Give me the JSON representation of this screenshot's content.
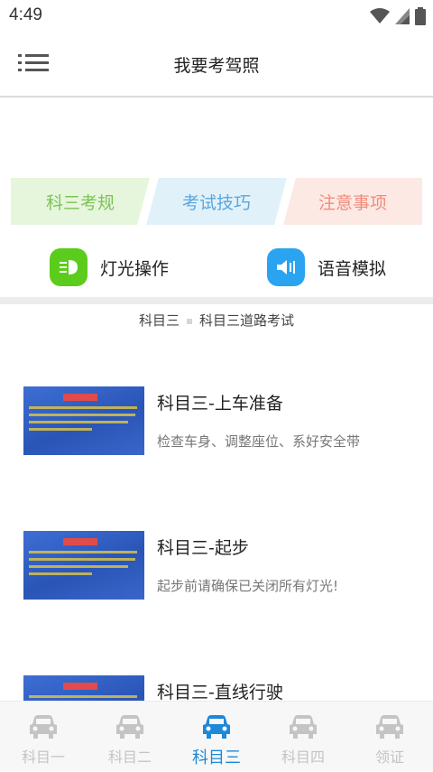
{
  "status": {
    "time": "4:49"
  },
  "header": {
    "title": "我要考驾照",
    "menu_icon": "menu-list-icon"
  },
  "pill_tabs": [
    {
      "label": "科三考规",
      "text_color": "#7cc356",
      "bg_color": "#e6f6dc"
    },
    {
      "label": "考试技巧",
      "text_color": "#5aa6dc",
      "bg_color": "#e1f1fa"
    },
    {
      "label": "注意事项",
      "text_color": "#f08c7c",
      "bg_color": "#fde9e4"
    }
  ],
  "features": [
    {
      "label": "灯光操作",
      "icon": "headlight-icon",
      "color": "#5ccc1c"
    },
    {
      "label": "语音模拟",
      "icon": "speaker-icon",
      "color": "#2aa4f0"
    }
  ],
  "breadcrumb": {
    "first": "科目三",
    "second": "科目三道路考试"
  },
  "lessons": [
    {
      "title": "科目三-上车准备",
      "subtitle": "检查车身、调整座位、系好安全带"
    },
    {
      "title": "科目三-起步",
      "subtitle": "起步前请确保已关闭所有灯光!"
    },
    {
      "title": "科目三-直线行驶",
      "subtitle": ""
    }
  ],
  "bottom_nav": [
    {
      "label": "科目一",
      "active": false
    },
    {
      "label": "科目二",
      "active": false
    },
    {
      "label": "科目三",
      "active": true
    },
    {
      "label": "科目四",
      "active": false
    },
    {
      "label": "领证",
      "active": false
    }
  ],
  "colors": {
    "active": "#1e88d9",
    "inactive": "#c4c4c4"
  }
}
